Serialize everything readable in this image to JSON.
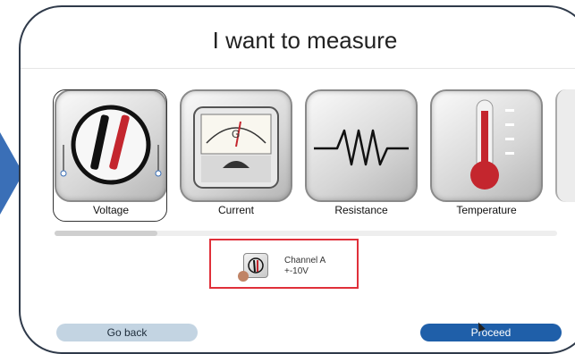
{
  "title": "I want to measure",
  "options": [
    {
      "label": "Voltage",
      "icon": "voltmeter-probes-icon",
      "selected": true
    },
    {
      "label": "Current",
      "icon": "analog-meter-icon"
    },
    {
      "label": "Resistance",
      "icon": "resistor-icon"
    },
    {
      "label": "Temperature",
      "icon": "thermometer-icon"
    }
  ],
  "channel": {
    "name": "Channel A",
    "range": "+-10V",
    "icon": "probe-icon"
  },
  "buttons": {
    "back": "Go back",
    "proceed": "Proceed"
  },
  "colors": {
    "accent": "#1f5fa9",
    "highlight": "#e0303a",
    "arrow": "#3a6fb7"
  }
}
